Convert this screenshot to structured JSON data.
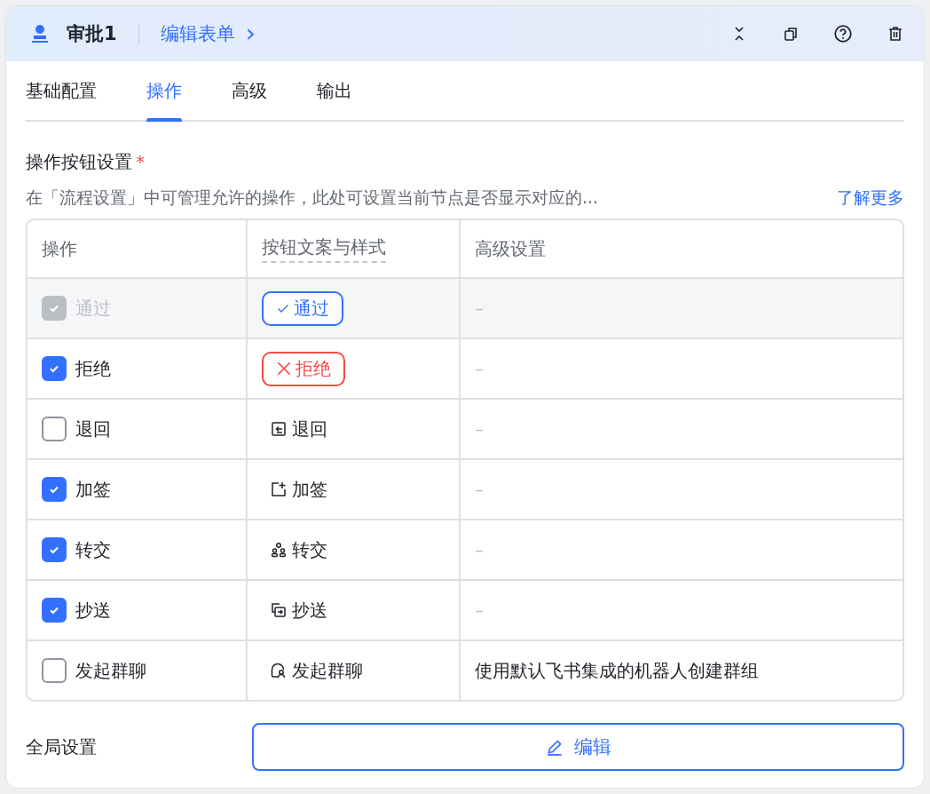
{
  "header": {
    "title": "审批1",
    "link": "编辑表单",
    "link_arrow": "›"
  },
  "tabs": [
    {
      "label": "基础配置",
      "selected": false
    },
    {
      "label": "操作",
      "selected": true
    },
    {
      "label": "高级",
      "selected": false
    },
    {
      "label": "输出",
      "selected": false
    }
  ],
  "section": {
    "title": "操作按钮设置",
    "required_mark": "*",
    "description": "在「流程设置」中可管理允许的操作，此处可设置当前节点是否显示对应的...",
    "learn_more": "了解更多"
  },
  "table": {
    "columns": [
      "操作",
      "按钮文案与样式",
      "高级设置"
    ],
    "rows": [
      {
        "action": "通过",
        "checked": true,
        "disabled": true,
        "button": "通过",
        "kind": "primary",
        "advanced": "–"
      },
      {
        "action": "拒绝",
        "checked": true,
        "disabled": false,
        "button": "拒绝",
        "kind": "danger",
        "advanced": "–"
      },
      {
        "action": "退回",
        "checked": false,
        "disabled": false,
        "button": "退回",
        "kind": "text",
        "advanced": "–"
      },
      {
        "action": "加签",
        "checked": true,
        "disabled": false,
        "button": "加签",
        "kind": "text",
        "advanced": "–"
      },
      {
        "action": "转交",
        "checked": true,
        "disabled": false,
        "button": "转交",
        "kind": "text",
        "advanced": "–"
      },
      {
        "action": "抄送",
        "checked": true,
        "disabled": false,
        "button": "抄送",
        "kind": "text",
        "advanced": "–"
      },
      {
        "action": "发起群聊",
        "checked": false,
        "disabled": false,
        "button": "发起群聊",
        "kind": "text",
        "advanced": "使用默认飞书集成的机器人创建群组"
      }
    ]
  },
  "global": {
    "label": "全局设置",
    "button": "编辑"
  }
}
